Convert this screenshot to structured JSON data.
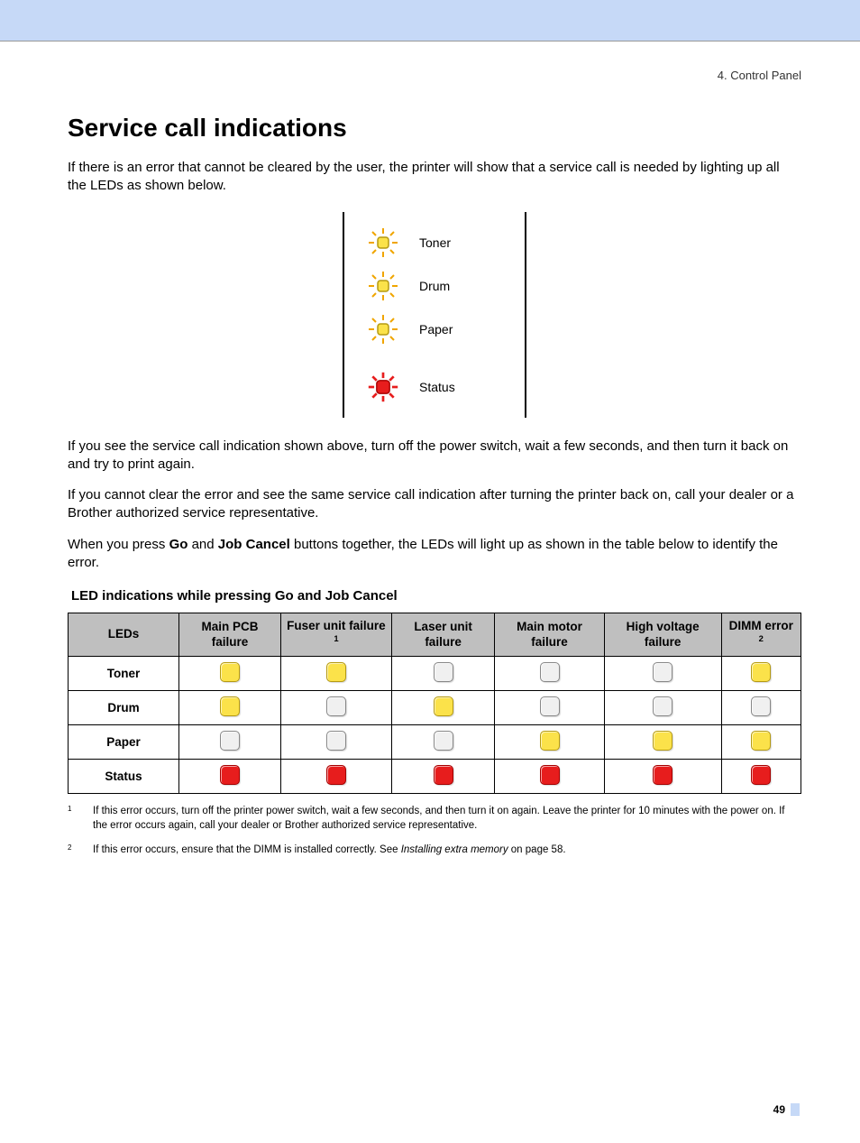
{
  "header": {
    "section": "4. Control Panel"
  },
  "title": "Service call indications",
  "para1": "If there is an error that cannot be cleared by the user, the printer will show that a service call is needed by lighting up all the LEDs as shown below.",
  "panel": {
    "rows": [
      {
        "label": "Toner",
        "type": "yellow-blink"
      },
      {
        "label": "Drum",
        "type": "yellow-blink"
      },
      {
        "label": "Paper",
        "type": "yellow-blink"
      },
      {
        "label": "Status",
        "type": "red-blink"
      }
    ]
  },
  "para2": "If you see the service call indication shown above, turn off the power switch, wait a few seconds, and then turn it back on and try to print again.",
  "para3": "If you cannot clear the error and see the same service call indication after turning the printer back on, call your dealer or a Brother authorized service representative.",
  "para4_pre": "When you press ",
  "para4_b1": "Go",
  "para4_mid": " and ",
  "para4_b2": "Job Cancel",
  "para4_post": " buttons together, the LEDs will light up as shown in the table below to identify the error.",
  "table": {
    "caption": "LED indications while pressing Go and Job Cancel",
    "cols": [
      "LEDs",
      "Main PCB failure",
      "Fuser unit failure",
      "Laser unit failure",
      "Main motor failure",
      "High voltage failure",
      "DIMM error"
    ],
    "col_fn": {
      "2": "1",
      "6": "2"
    },
    "rows": [
      {
        "name": "Toner",
        "cells": [
          "yellow",
          "yellow",
          "off",
          "off",
          "off",
          "yellow"
        ]
      },
      {
        "name": "Drum",
        "cells": [
          "yellow",
          "off",
          "yellow",
          "off",
          "off",
          "off"
        ]
      },
      {
        "name": "Paper",
        "cells": [
          "off",
          "off",
          "off",
          "yellow",
          "yellow",
          "yellow"
        ]
      },
      {
        "name": "Status",
        "cells": [
          "red",
          "red",
          "red",
          "red",
          "red",
          "red"
        ]
      }
    ]
  },
  "footnotes": {
    "f1_num": "1",
    "f1_text": "If this error occurs, turn off the printer power switch, wait a few seconds, and then turn it on again. Leave the printer for 10 minutes with the power on. If the error occurs again, call your dealer or Brother authorized service representative.",
    "f2_num": "2",
    "f2_pre": "If this error occurs, ensure that the DIMM is installed correctly. See ",
    "f2_em": "Installing extra memory",
    "f2_post": " on page 58."
  },
  "page_number": "49",
  "chart_data": {
    "type": "table",
    "title": "LED indications while pressing Go and Job Cancel",
    "columns": [
      "Main PCB failure",
      "Fuser unit failure",
      "Laser unit failure",
      "Main motor failure",
      "High voltage failure",
      "DIMM error"
    ],
    "rows": [
      "Toner",
      "Drum",
      "Paper",
      "Status"
    ],
    "legend": {
      "yellow": "on (yellow)",
      "off": "off (grey)",
      "red": "on (red)"
    },
    "values": [
      [
        "yellow",
        "yellow",
        "off",
        "off",
        "off",
        "yellow"
      ],
      [
        "yellow",
        "off",
        "yellow",
        "off",
        "off",
        "off"
      ],
      [
        "off",
        "off",
        "off",
        "yellow",
        "yellow",
        "yellow"
      ],
      [
        "red",
        "red",
        "red",
        "red",
        "red",
        "red"
      ]
    ]
  }
}
